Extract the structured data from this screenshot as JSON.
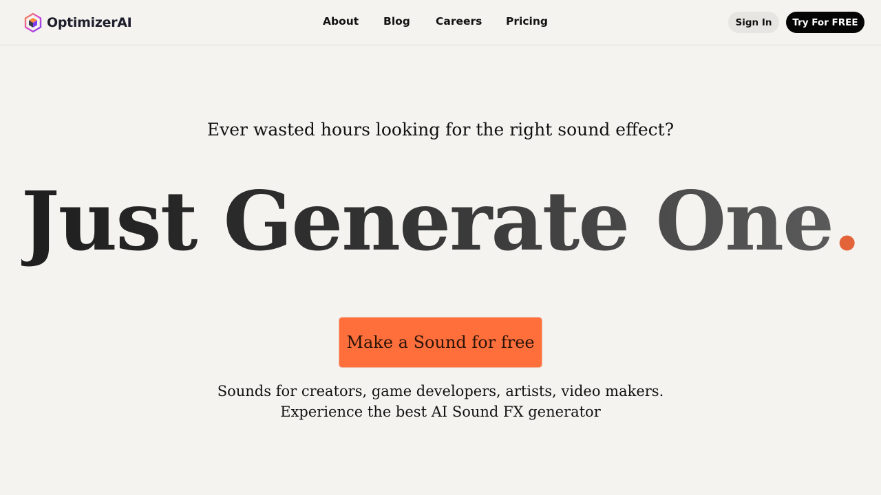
{
  "header": {
    "brand": "OptimizerAI",
    "nav": [
      "About",
      "Blog",
      "Careers",
      "Pricing"
    ],
    "sign_in_label": "Sign In",
    "try_label": "Try For FREE"
  },
  "hero": {
    "subtitle": "Ever wasted hours looking for the right sound effect?",
    "headline": "Just Generate One",
    "headline_dot": ".",
    "cta_label": "Make a Sound for free",
    "description_line1": "Sounds for creators, game developers, artists, video makers.",
    "description_line2": "Experience the best AI Sound FX generator"
  },
  "icons": {
    "logo": "hexagon-cube-logo-icon"
  },
  "colors": {
    "background": "#f4f3ef",
    "accent": "#ff6f3c",
    "dot": "#e4643a",
    "primary_button": "#050505",
    "secondary_button": "#e6e5e2"
  }
}
